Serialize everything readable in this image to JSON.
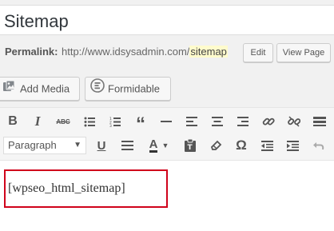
{
  "post": {
    "title": "Sitemap",
    "permalink_label": "Permalink:",
    "permalink_base": "http://www.idsysadmin.com/",
    "permalink_slug": "sitemap",
    "edit_label": "Edit",
    "view_label": "View Page"
  },
  "media_buttons": {
    "add_media": "Add Media",
    "formidable": "Formidable"
  },
  "toolbar": {
    "row1": [
      "bold-icon",
      "italic-icon",
      "strikethrough-icon",
      "bullet-list-icon",
      "numbered-list-icon",
      "blockquote-icon",
      "horizontal-line-icon",
      "align-left-icon",
      "align-center-icon",
      "align-right-icon",
      "link-icon",
      "unlink-icon",
      "toolbar-toggle-icon"
    ],
    "format_select": "Paragraph",
    "row2": [
      "underline-icon",
      "justify-icon",
      "text-color-icon",
      "paste-text-icon",
      "clear-formatting-icon",
      "special-character-icon",
      "outdent-icon",
      "indent-icon",
      "undo-icon"
    ]
  },
  "editor": {
    "content": "[wpseo_html_sitemap]",
    "highlight_color": "#d0021b"
  }
}
